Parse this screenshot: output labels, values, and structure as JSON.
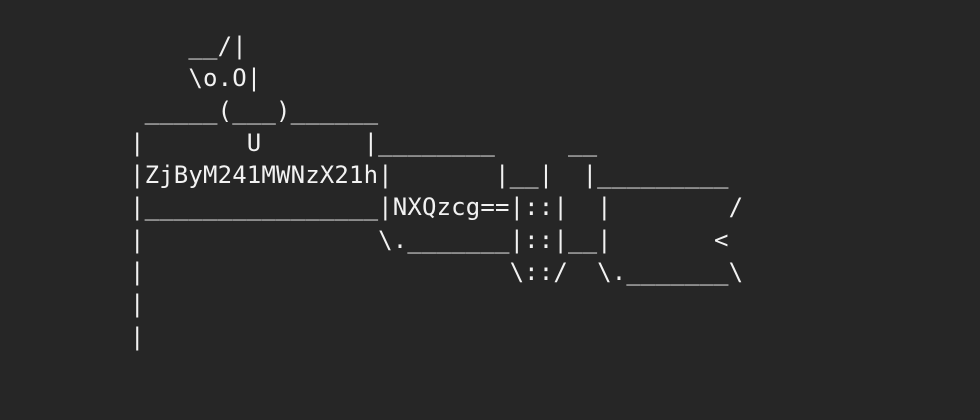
{
  "colors": {
    "background": "#262626",
    "text": "#f2f2f2"
  },
  "ascii_art": {
    "lines": [
      "    __/|",
      "    \\o.O|",
      " _____(___)______",
      "|       U       |________     __",
      "|ZjByM241MWNzX21h|       |__|  |_________",
      "|________________|NXQzcg==|::|  |        /",
      "|                \\._______|::|__|       <",
      "|                         \\::/  \\._______\\",
      "|",
      "|"
    ]
  }
}
